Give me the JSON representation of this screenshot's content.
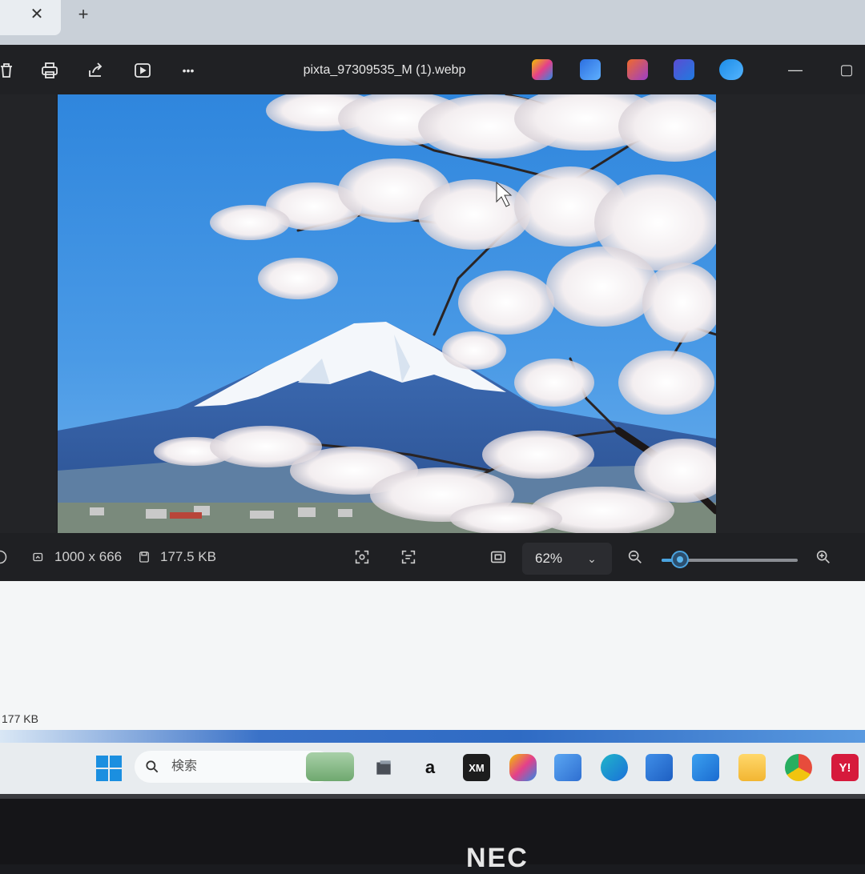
{
  "browser": {
    "close_glyph": "✕",
    "new_tab_glyph": "+"
  },
  "viewer": {
    "file_name": "pixta_97309535_M (1).webp",
    "toolbar_icons": [
      "trash-icon",
      "print-icon",
      "share-icon",
      "slideshow-icon",
      "more-icon"
    ],
    "more_label": "•••",
    "app_icons": [
      "copilot-icon",
      "designer-icon",
      "clipchamp-icon",
      "photos-editor-icon",
      "onedrive-icon"
    ],
    "minimize_glyph": "—",
    "maximize_glyph": "▢"
  },
  "status": {
    "dimensions": "1000 x 666",
    "file_size": "177.5 KB",
    "zoom": "62%",
    "zoom_fraction": 0.14,
    "chevron": "⌄"
  },
  "explorer": {
    "size_label": "177 KB"
  },
  "taskbar": {
    "search_placeholder": "検索",
    "amazon_label": "a",
    "xm_label": "XM",
    "yahoo_label": "Y!"
  },
  "bezel": {
    "brand": "NEC"
  },
  "colors": {
    "sky": "#3d8fe0",
    "accent": "#4aa3df",
    "taskbar": "#e8ecef"
  }
}
